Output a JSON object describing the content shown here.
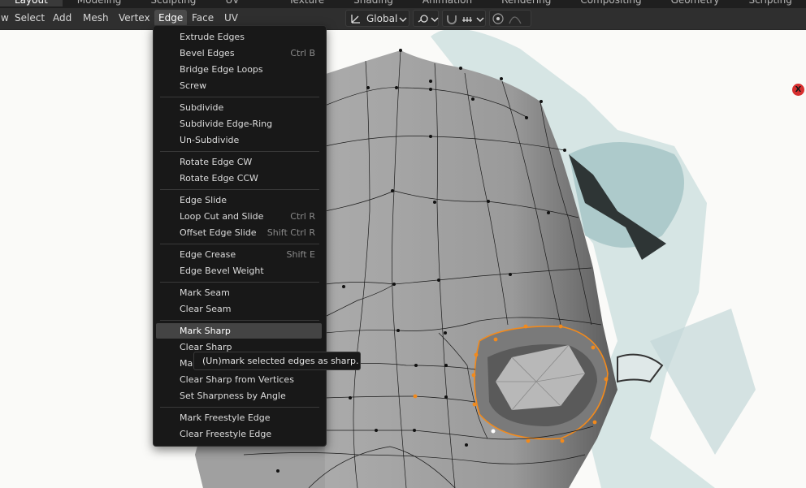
{
  "workspace_tabs": [
    "Layout",
    "Modeling",
    "Sculpting",
    "UV Editing",
    "Texture Paint",
    "Shading",
    "Animation",
    "Rendering",
    "Compositing",
    "Geometry Nodes",
    "Scripting"
  ],
  "header": {
    "menus": [
      "Select",
      "Add",
      "Mesh",
      "Vertex",
      "Edge",
      "Face",
      "UV"
    ],
    "view_fragment": "w",
    "transform_orientation": "Global"
  },
  "edge_menu": {
    "groups": [
      [
        {
          "label": "Extrude Edges",
          "shortcut": ""
        },
        {
          "label": "Bevel Edges",
          "shortcut": "Ctrl B"
        },
        {
          "label": "Bridge Edge Loops",
          "shortcut": ""
        },
        {
          "label": "Screw",
          "shortcut": ""
        }
      ],
      [
        {
          "label": "Subdivide",
          "shortcut": ""
        },
        {
          "label": "Subdivide Edge-Ring",
          "shortcut": ""
        },
        {
          "label": "Un-Subdivide",
          "shortcut": ""
        }
      ],
      [
        {
          "label": "Rotate Edge CW",
          "shortcut": ""
        },
        {
          "label": "Rotate Edge CCW",
          "shortcut": ""
        }
      ],
      [
        {
          "label": "Edge Slide",
          "shortcut": ""
        },
        {
          "label": "Loop Cut and Slide",
          "shortcut": "Ctrl R"
        },
        {
          "label": "Offset Edge Slide",
          "shortcut": "Shift Ctrl R"
        }
      ],
      [
        {
          "label": "Edge Crease",
          "shortcut": "Shift E"
        },
        {
          "label": "Edge Bevel Weight",
          "shortcut": ""
        }
      ],
      [
        {
          "label": "Mark Seam",
          "shortcut": ""
        },
        {
          "label": "Clear Seam",
          "shortcut": ""
        }
      ],
      [
        {
          "label": "Mark Sharp",
          "shortcut": "",
          "highlighted": true
        },
        {
          "label": "Clear Sharp",
          "shortcut": ""
        },
        {
          "label": "Mark Sharp from Vertices",
          "shortcut": ""
        },
        {
          "label": "Clear Sharp from Vertices",
          "shortcut": ""
        },
        {
          "label": "Set Sharpness by Angle",
          "shortcut": ""
        }
      ],
      [
        {
          "label": "Mark Freestyle Edge",
          "shortcut": ""
        },
        {
          "label": "Clear Freestyle Edge",
          "shortcut": ""
        }
      ]
    ]
  },
  "tooltip": "(Un)mark selected edges as sharp.",
  "close_marker": "X",
  "colors": {
    "selection_orange": "#f28a1c",
    "menu_bg": "#181818",
    "header_bg": "#2f2f2f",
    "highlight": "#444444"
  }
}
